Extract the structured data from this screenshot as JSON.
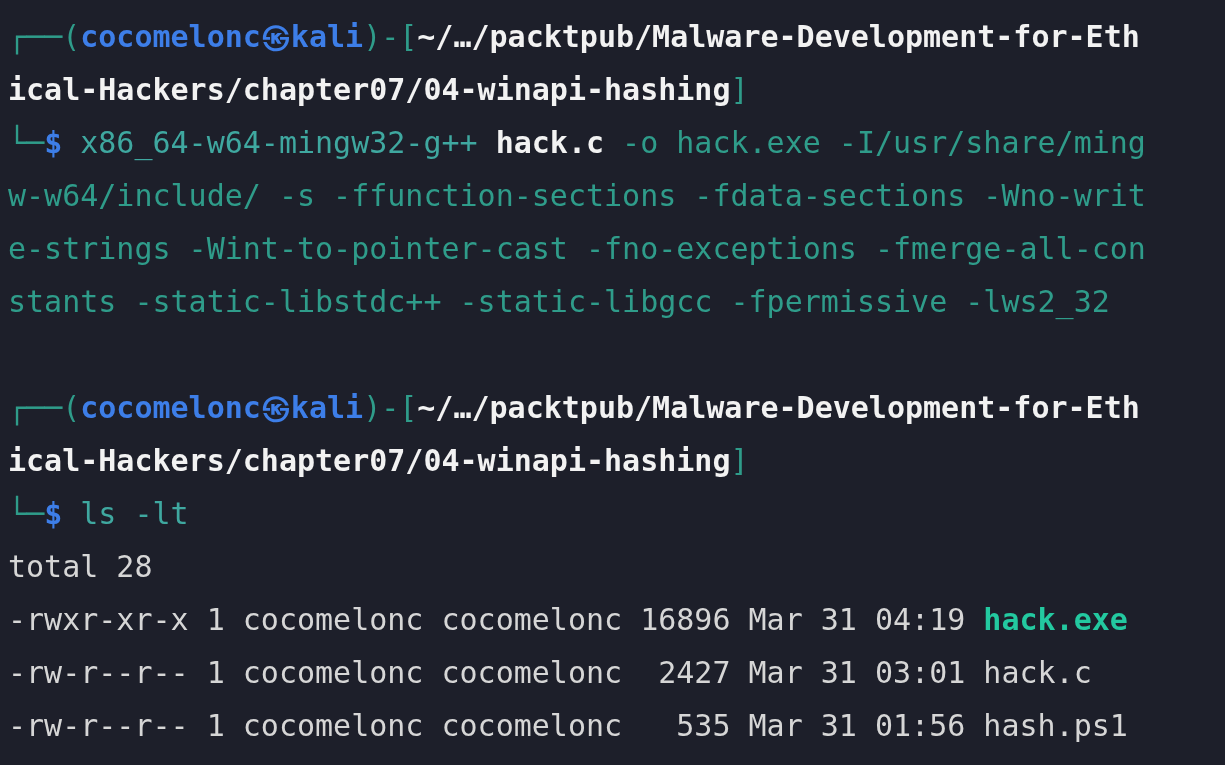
{
  "terminal": {
    "blocks": [
      {
        "lines": [
          {
            "segments": [
              {
                "kind": "frame",
                "text": "┌──("
              },
              {
                "kind": "user",
                "text": "cocomelonc㉿kali"
              },
              {
                "kind": "frame",
                "text": ")-["
              },
              {
                "kind": "path",
                "text": "~/…/packtpub/Malware-Development-for-Eth"
              }
            ]
          },
          {
            "segments": [
              {
                "kind": "path",
                "text": "ical-Hackers/chapter07/04-winapi-hashing"
              },
              {
                "kind": "frame",
                "text": "]"
              }
            ]
          },
          {
            "segments": [
              {
                "kind": "frame",
                "text": "└─"
              },
              {
                "kind": "prompt",
                "text": "$"
              },
              {
                "kind": "command",
                "text": " x86_64-w64-mingw32-g++"
              },
              {
                "kind": "file",
                "text": " hack.c"
              },
              {
                "kind": "arg",
                "text": " -o hack.exe -I/usr/share/ming"
              }
            ]
          },
          {
            "segments": [
              {
                "kind": "arg",
                "text": "w-w64/include/ -s -ffunction-sections -fdata-sections -Wno-writ"
              }
            ]
          },
          {
            "segments": [
              {
                "kind": "arg",
                "text": "e-strings -Wint-to-pointer-cast -fno-exceptions -fmerge-all-con"
              }
            ]
          },
          {
            "segments": [
              {
                "kind": "arg",
                "text": "stants -static-libstdc++ -static-libgcc -fpermissive -lws2_32"
              }
            ]
          }
        ]
      },
      {
        "lines": [
          {
            "segments": [
              {
                "kind": "frame",
                "text": "┌──("
              },
              {
                "kind": "user",
                "text": "cocomelonc㉿kali"
              },
              {
                "kind": "frame",
                "text": ")-["
              },
              {
                "kind": "path",
                "text": "~/…/packtpub/Malware-Development-for-Eth"
              }
            ]
          },
          {
            "segments": [
              {
                "kind": "path",
                "text": "ical-Hackers/chapter07/04-winapi-hashing"
              },
              {
                "kind": "frame",
                "text": "]"
              }
            ]
          },
          {
            "segments": [
              {
                "kind": "frame",
                "text": "└─"
              },
              {
                "kind": "prompt",
                "text": "$"
              },
              {
                "kind": "command",
                "text": " ls -lt"
              }
            ]
          },
          {
            "segments": [
              {
                "kind": "output",
                "text": "total 28"
              }
            ]
          },
          {
            "segments": [
              {
                "kind": "output",
                "text": "-rwxr-xr-x 1 cocomelonc cocomelonc 16896 Mar 31 04:19"
              },
              {
                "kind": "exec",
                "text": " hack.exe"
              }
            ]
          },
          {
            "segments": [
              {
                "kind": "output",
                "text": "-rw-r--r-- 1 cocomelonc cocomelonc  2427 Mar 31 03:01 hack.c"
              }
            ]
          },
          {
            "segments": [
              {
                "kind": "output",
                "text": "-rw-r--r-- 1 cocomelonc cocomelonc   535 Mar 31 01:56 hash.ps1"
              }
            ]
          }
        ]
      }
    ]
  }
}
